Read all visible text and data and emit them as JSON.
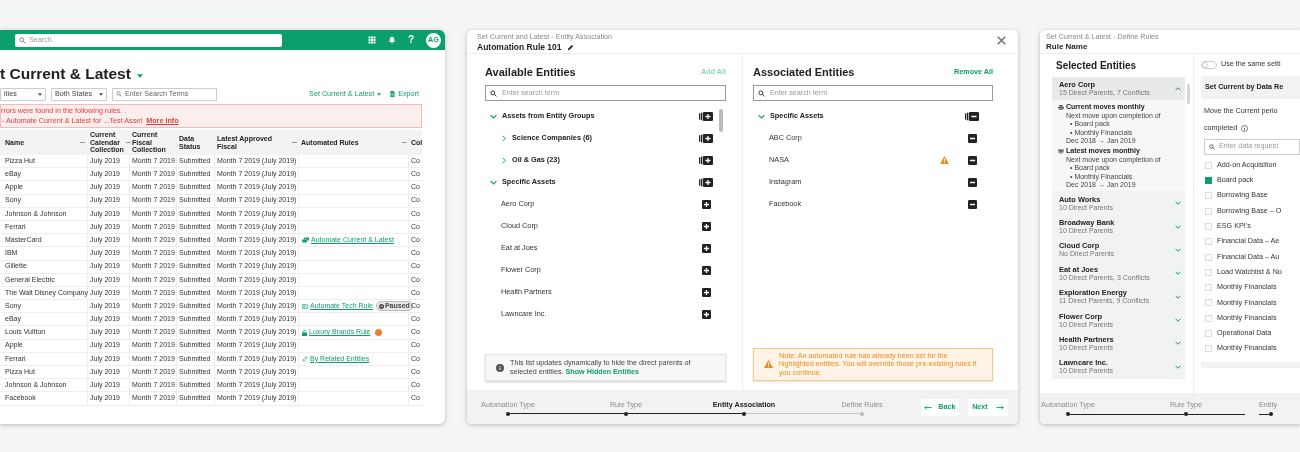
{
  "grid": {
    "topbar": {
      "search_placeholder": "Search",
      "help": "?",
      "avatar": "AG"
    },
    "title": "t Current & Latest",
    "filters": [
      "ities",
      "Both States"
    ],
    "search_placeholder": "Enter Search Terms",
    "menu_button": "Set Current & Latest",
    "export_button": "Export",
    "error": {
      "message": "rrors were found in the following rules. .",
      "detail": "- Automate Current & Latest for ...Test Asset",
      "link": "More info"
    },
    "table": {
      "columns": [
        {
          "label": "Name",
          "menu": true
        },
        {
          "label": "Current Calendar Collection",
          "menu": true
        },
        {
          "label": "Current Fiscal Collection",
          "menu": false
        },
        {
          "label": "Data Status",
          "menu": false
        },
        {
          "label": "Latest Approved Fiscal",
          "menu": true
        },
        {
          "label": "Automated Rules",
          "menu": true
        },
        {
          "label": "Col",
          "menu": false
        }
      ],
      "rows": [
        {
          "cells": [
            "Pizza Hut",
            "July 2019",
            "Month 7 2019",
            "Submitted",
            "Month 7 2019 (July 2019)",
            "Co"
          ]
        },
        {
          "cells": [
            "eBay",
            "July 2019",
            "Month 7 2019",
            "Submitted",
            "Month 7 2019 (July 2019)",
            "Co"
          ]
        },
        {
          "cells": [
            "Apple",
            "July 2019",
            "Month 7 2019",
            "Submitted",
            "Month 7 2019 (July 2019)",
            "Co"
          ]
        },
        {
          "cells": [
            "Sony",
            "July 2019",
            "Month 7 2019",
            "Submitted",
            "Month 7 2019 (July 2019)",
            "Co"
          ]
        },
        {
          "cells": [
            "Johnson & Johnson",
            "July 2019",
            "Month 7 2019",
            "Submitted",
            "Month 7 2019 (July 2019)",
            "Co"
          ]
        },
        {
          "cells": [
            "Ferrari",
            "July 2019",
            "Month 7 2019",
            "Submitted",
            "Month 7 2019 (July 2019)",
            "Co"
          ]
        },
        {
          "cells": [
            "MasterCard",
            "July 2019",
            "Month 7 2019",
            "Submitted",
            "Month 7 2019 (July 2019)",
            "Co"
          ],
          "rule": {
            "kind": "cards",
            "text": "Automate Current & Latest"
          }
        },
        {
          "cells": [
            "IBM",
            "July 2019",
            "Month 7 2019",
            "Submitted",
            "Month 7 2019 (July 2019)",
            "Co"
          ]
        },
        {
          "cells": [
            "Gillette",
            "July 2019",
            "Month 7 2019",
            "Submitted",
            "Month 7 2019 (July 2019)",
            "Co"
          ]
        },
        {
          "cells": [
            "General Electric",
            "July 2019",
            "Month 7 2019",
            "Submitted",
            "Month 7 2019 (July 2019)",
            "Co"
          ]
        },
        {
          "cells": [
            "The Walt Disney Company",
            "July 2019",
            "Month 7 2019",
            "Submitted",
            "Month 7 2019 (July 2019)",
            "Co"
          ]
        },
        {
          "cells": [
            "Sony",
            "July 2019",
            "Month 7 2019",
            "Submitted",
            "Month 7 2019 (July 2019)",
            "Co"
          ],
          "rule": {
            "kind": "table",
            "text": "Automate Tech Rule",
            "badge": "Paused"
          }
        },
        {
          "cells": [
            "eBay",
            "July 2019",
            "Month 7 2019",
            "Submitted",
            "Month 7 2019 (July 2019)",
            "Co"
          ]
        },
        {
          "cells": [
            "Louis Vuitton",
            "July 2019",
            "Month 7 2019",
            "Submitted",
            "Month 7 2019 (July 2019)",
            "Co"
          ],
          "rule": {
            "kind": "lock",
            "text": "Luxury Brands Rule",
            "alert": true
          }
        },
        {
          "cells": [
            "Apple",
            "July 2019",
            "Month 7 2019",
            "Submitted",
            "Month 7 2019 (July 2019)",
            "Co"
          ]
        },
        {
          "cells": [
            "Ferrari",
            "July 2019",
            "Month 7 2019",
            "Submitted",
            "Month 7 2019 (July 2019)",
            "Co"
          ],
          "rule": {
            "kind": "link",
            "text": "By Related Entities"
          }
        },
        {
          "cells": [
            "Pizza Hut",
            "July 2019",
            "Month 7 2019",
            "Submitted",
            "Month 7 2019 (July 2019)",
            "Co"
          ]
        },
        {
          "cells": [
            "Johnson & Johnson",
            "July 2019",
            "Month 7 2019",
            "Submitted",
            "Month 7 2019 (July 2019)",
            "Co"
          ]
        },
        {
          "cells": [
            "Facebook",
            "July 2019",
            "Month 7 2019",
            "Submitted",
            "Month 7 2019 (July 2019)",
            "Co"
          ]
        }
      ]
    }
  },
  "association_dialog": {
    "subtitle": "Set Current and Latest - Entity Association",
    "title": "Automation Rule 101",
    "available": {
      "heading": "Available Entities",
      "action": "Add All",
      "action_disabled": true,
      "search_placeholder": "Enter search term",
      "tree": [
        {
          "kind": "group",
          "label": "Assets from Entity Groups",
          "expanded": true,
          "children": [
            {
              "kind": "group",
              "label": "Science Companies (6)",
              "expanded": false
            },
            {
              "kind": "group",
              "label": "Oil & Gas (23)",
              "expanded": false
            }
          ]
        },
        {
          "kind": "group",
          "label": "Specific Assets",
          "expanded": true,
          "children": [
            {
              "kind": "item",
              "label": "Aero Corp",
              "warning": false
            },
            {
              "kind": "item",
              "label": "Cloud Corp",
              "warning": false
            },
            {
              "kind": "item",
              "label": "Eat at Joes",
              "warning": false
            },
            {
              "kind": "item",
              "label": "Flower Corp",
              "warning": false
            },
            {
              "kind": "item",
              "label": "Health Partners",
              "warning": false
            },
            {
              "kind": "item",
              "label": "Lawncare Inc.",
              "warning": false
            }
          ]
        }
      ],
      "note": {
        "kind": "info",
        "text": "This list updates dynamically to hide the direct parents of selected entities.",
        "link": "Show Hidden Entities"
      }
    },
    "associated": {
      "heading": "Associated Entities",
      "action": "Remove All",
      "action_disabled": false,
      "search_placeholder": "Enter search term",
      "tree": [
        {
          "kind": "group",
          "label": "Specific Assets",
          "expanded": true,
          "children": [
            {
              "kind": "item",
              "label": "ABC Corp",
              "warning": false
            },
            {
              "kind": "item",
              "label": "NASA",
              "warning": true
            },
            {
              "kind": "item",
              "label": "Instagram",
              "warning": false
            },
            {
              "kind": "item",
              "label": "Facebook",
              "warning": false
            }
          ]
        }
      ],
      "note": {
        "kind": "warning",
        "text": "Note: An automated rule has already been set for the highlighted entities. You will override those pre-existing rules if you continue."
      }
    },
    "steps": [
      {
        "label": "Automation Type",
        "completed": true,
        "current": false
      },
      {
        "label": "Rule Type",
        "completed": true,
        "current": false
      },
      {
        "label": "Entity Association",
        "completed": true,
        "current": true
      },
      {
        "label": "Define Rules",
        "completed": false,
        "current": false
      }
    ],
    "back_button": "Back",
    "next_button": "Next"
  },
  "rules_dialog": {
    "subtitle": "Set Current & Latest - Define Rules",
    "title": "Rule Name",
    "entities_heading": "Selected Entities",
    "entities": [
      {
        "name": "Aero Corp",
        "summary": "15 Direct Parents, 7 Conflicts",
        "expanded": true,
        "periods": [
          {
            "kind": "current",
            "heading": "Current moves monthly",
            "lead": "Next move upon completion of",
            "items": [
              "• Board pack",
              "• Monthly Financials"
            ],
            "range": "Dec 2018 → Jan 2019"
          },
          {
            "kind": "latest",
            "heading": "Latest moves monthly",
            "lead": "Next move upon completion of",
            "items": [
              "• Board pack",
              "• Monthly Financials"
            ],
            "range": "Dec 2018 → Jan 2019"
          }
        ]
      },
      {
        "name": "Auto Works",
        "summary": "10 Direct Parents",
        "expanded": false
      },
      {
        "name": "Broadway Bank",
        "summary": "10 Direct Parents",
        "expanded": false
      },
      {
        "name": "Cloud Corp",
        "summary": "No Direct Parents",
        "expanded": false
      },
      {
        "name": "Eat at Joes",
        "summary": "10 Direct Parents, 3 Conflicts",
        "expanded": false
      },
      {
        "name": "Exploration Energy",
        "summary": "11 Direct Parents, 9 Conflicts",
        "expanded": false
      },
      {
        "name": "Flower Corp",
        "summary": "10 Direct Parents",
        "expanded": false
      },
      {
        "name": "Health Partners",
        "summary": "10 Direct Parents",
        "expanded": false
      },
      {
        "name": "Lawncare Inc.",
        "summary": "10 Direct Parents",
        "expanded": false
      }
    ],
    "toggle": {
      "on": false,
      "label": "Use the same setti"
    },
    "section": "Set Current by Data Re",
    "prompt": "Move the Current perio",
    "prompt_end": "completed",
    "search_placeholder": "Enter data request",
    "options": [
      {
        "label": "Add-on Acquisition",
        "checked": false
      },
      {
        "label": "Board pack",
        "checked": true
      },
      {
        "label": "Borrowing Base",
        "checked": false
      },
      {
        "label": "Borrowing Base – O",
        "checked": false
      },
      {
        "label": "ESG KPI's",
        "checked": false
      },
      {
        "label": "Financial Data – Ae",
        "checked": false
      },
      {
        "label": "Financial Data – Au",
        "checked": false
      },
      {
        "label": "Load Watchlist & No",
        "checked": false
      },
      {
        "label": "Monthly Financials",
        "checked": false
      },
      {
        "label": "Monthly Financials",
        "checked": false
      },
      {
        "label": "Monthly Financials",
        "checked": false
      },
      {
        "label": "Operational Data",
        "checked": false
      },
      {
        "label": "Monthly Financials",
        "checked": false
      }
    ],
    "steps": [
      {
        "label": "Automation Type",
        "completed": true,
        "current": false
      },
      {
        "label": "Rule Type",
        "completed": true,
        "current": false
      },
      {
        "label": "Entity",
        "completed": true,
        "current": false
      }
    ]
  }
}
